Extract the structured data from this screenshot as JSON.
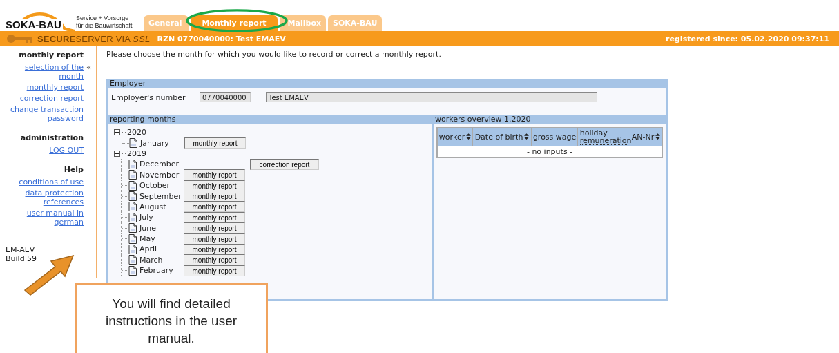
{
  "header": {
    "logo": {
      "name": "SOKA-BAU",
      "tagline_1": "Service + Vorsorge",
      "tagline_2": "für die Bauwirtschaft"
    },
    "tabs": [
      {
        "label": "General",
        "selected": false
      },
      {
        "label": "Monthly report",
        "selected": true
      },
      {
        "label": "Mailbox",
        "selected": false
      },
      {
        "label": "SOKA-BAU",
        "selected": false
      }
    ],
    "bar": {
      "secure_label": "**SECURE**SERVER VIA *SSL*",
      "account": "RZN 0770040000: Test EMAEV",
      "registered": "registered since:  05.02.2020 09:37:11"
    }
  },
  "sidebar": {
    "selection_marker": "«",
    "sections": [
      {
        "title": "monthly report",
        "items": [
          {
            "label": "selection of the month",
            "selected": true
          },
          {
            "label": "monthly report",
            "selected": false
          },
          {
            "label": "correction report",
            "selected": false
          },
          {
            "label": "change transaction password",
            "selected": false
          }
        ]
      },
      {
        "title": "administration",
        "items": [
          {
            "label": "LOG OUT",
            "selected": false
          }
        ]
      },
      {
        "title": "Help",
        "items": [
          {
            "label": "conditions of use",
            "selected": false
          },
          {
            "label": "data protection references",
            "selected": false
          },
          {
            "label": "user manual in german",
            "selected": false
          }
        ]
      }
    ],
    "version": "EM-AEV",
    "build": "Build 59"
  },
  "main": {
    "instruction": "Please choose the month for which you would like to record or correct a monthly report.",
    "employer": {
      "title": "Employer",
      "label": "Employer's number",
      "number": "0770040000",
      "name": "Test EMAEV"
    },
    "reporting_months": {
      "title": "reporting months",
      "years": [
        {
          "label": "2020",
          "expanded": true,
          "children": [
            {
              "label": "January",
              "action": {
                "kind": "monthly",
                "label": "monthly report"
              }
            }
          ]
        },
        {
          "label": "2019",
          "expanded": true,
          "children": [
            {
              "label": "December",
              "action": {
                "kind": "correction",
                "label": "correction report"
              }
            },
            {
              "label": "November",
              "action": {
                "kind": "monthly",
                "label": "monthly report"
              }
            },
            {
              "label": "October",
              "action": {
                "kind": "monthly",
                "label": "monthly report"
              }
            },
            {
              "label": "September",
              "action": {
                "kind": "monthly",
                "label": "monthly report"
              }
            },
            {
              "label": "August",
              "action": {
                "kind": "monthly",
                "label": "monthly report"
              }
            },
            {
              "label": "July",
              "action": {
                "kind": "monthly",
                "label": "monthly report"
              }
            },
            {
              "label": "June",
              "action": {
                "kind": "monthly",
                "label": "monthly report"
              }
            },
            {
              "label": "May",
              "action": {
                "kind": "monthly",
                "label": "monthly report"
              }
            },
            {
              "label": "April",
              "action": {
                "kind": "monthly",
                "label": "monthly report"
              }
            },
            {
              "label": "March",
              "action": {
                "kind": "monthly",
                "label": "monthly report"
              }
            },
            {
              "label": "February",
              "action": {
                "kind": "monthly",
                "label": "monthly report"
              }
            }
          ]
        }
      ]
    },
    "workers": {
      "title": "workers overview 1.2020",
      "columns": [
        {
          "label": "worker",
          "sortable": true
        },
        {
          "label": "Date of birth",
          "sortable": true
        },
        {
          "label": "gross wage",
          "sortable": false
        },
        {
          "label": "holiday remuneration",
          "sortable": false
        },
        {
          "label": "AN-Nr",
          "sortable": true
        }
      ],
      "empty": "- no inputs -"
    }
  },
  "annotations": {
    "callout": "You will find detailed instructions in the user manual."
  }
}
